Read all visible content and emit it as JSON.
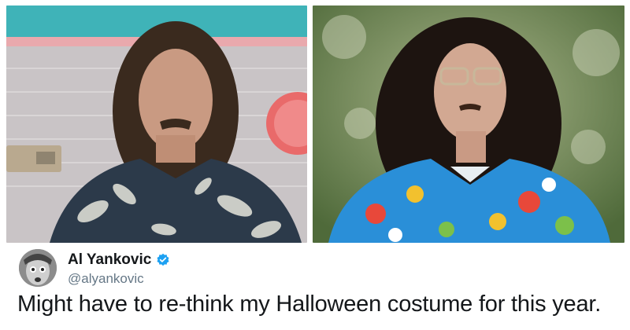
{
  "images": {
    "left": {
      "subject": "man-in-floral-shirt-indoor"
    },
    "right": {
      "subject": "man-in-wig-and-hawaiian-shirt-outdoor"
    }
  },
  "tweet": {
    "display_name": "Al Yankovic",
    "handle": "@alyankovic",
    "text": "Might have to re-think my Halloween costume for this year.",
    "verified": true,
    "verified_icon": "verified-badge-icon",
    "colors": {
      "name": "#14171a",
      "handle": "#657786",
      "verified": "#1da1f2"
    }
  }
}
